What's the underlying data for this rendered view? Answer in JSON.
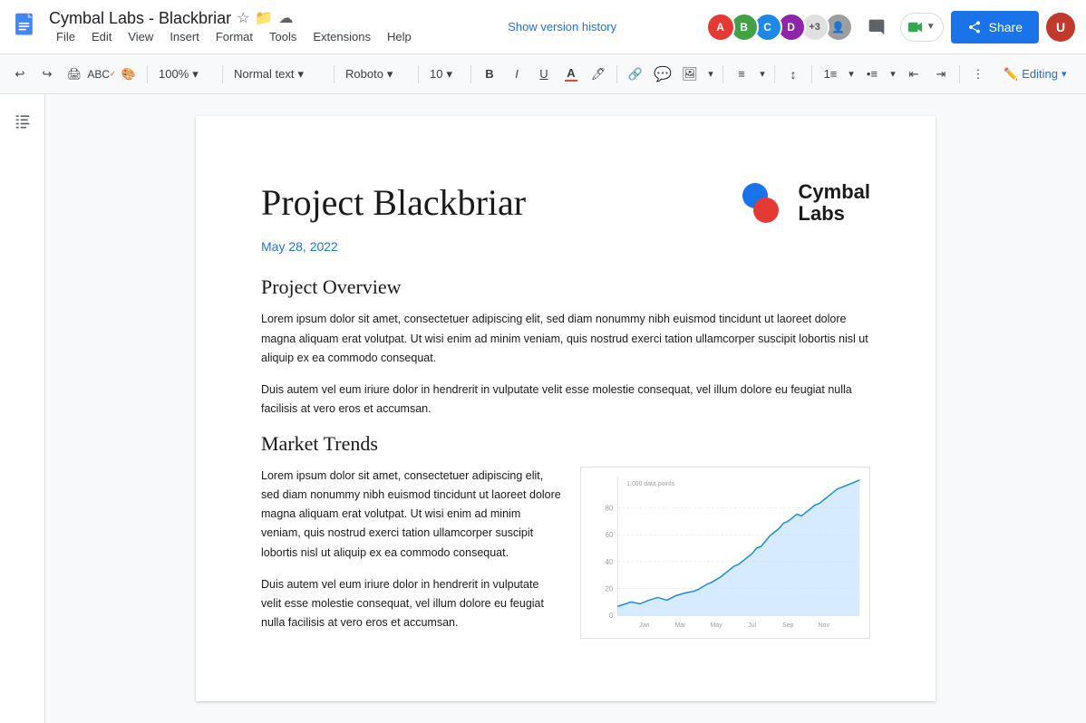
{
  "app": {
    "doc_icon_color": "#4285f4",
    "title": "Cymbal Labs - Blackbriar",
    "version_history": "Show version history",
    "menu": [
      "File",
      "Edit",
      "View",
      "Insert",
      "Format",
      "Tools",
      "Extensions",
      "Help"
    ]
  },
  "toolbar": {
    "zoom": "100%",
    "style": "Normal text",
    "font": "Roboto",
    "size": "10",
    "editing_label": "Editing"
  },
  "document": {
    "title": "Project Blackbriar",
    "logo_name": "Cymbal\nLabs",
    "date": "May 28, 2022",
    "section1_heading": "Project Overview",
    "section1_para1": "Lorem ipsum dolor sit amet, consectetuer adipiscing elit, sed diam nonummy nibh euismod tincidunt ut laoreet dolore magna aliquam erat volutpat. Ut wisi enim ad minim veniam, quis nostrud exerci tation ullamcorper suscipit lobortis nisl ut aliquip ex ea commodo consequat.",
    "section1_para2": "Duis autem vel eum iriure dolor in hendrerit in vulputate velit esse molestie consequat, vel illum dolore eu feugiat nulla facilisis at vero eros et accumsan.",
    "section2_heading": "Market Trends",
    "section2_para1": "Lorem ipsum dolor sit amet, consectetuer adipiscing elit, sed diam nonummy nibh euismod tincidunt ut laoreet dolore magna aliquam erat volutpat. Ut wisi enim ad minim veniam, quis nostrud exerci tation ullamcorper suscipit lobortis nisl ut aliquip ex ea commodo consequat.",
    "section2_para2": "Duis autem vel eum iriure dolor in hendrerit in vulputate velit esse molestie consequat, vel illum dolore eu feugiat nulla facilisis at vero eros et accumsan."
  },
  "share_btn": "Share",
  "avatars": [
    {
      "color": "#e53935",
      "initial": "A"
    },
    {
      "color": "#43a047",
      "initial": "B"
    },
    {
      "color": "#1e88e5",
      "initial": "C"
    },
    {
      "color": "#8e24aa",
      "initial": "D"
    }
  ],
  "avatar_count": "+3"
}
